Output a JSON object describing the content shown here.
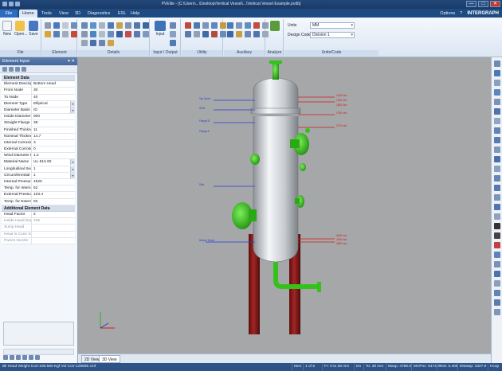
{
  "window": {
    "title": "PVElite - [C:\\Users\\...\\Desktop\\Vertical Vessel\\...\\Vertical Vessel Example.pvdb]",
    "minimize": "—",
    "maximize": "□",
    "close": "✕"
  },
  "menu": {
    "file": "File",
    "tabs": [
      "Home",
      "Tools",
      "View",
      "3D",
      "Diagnostics",
      "ESL",
      "Help"
    ],
    "options": "Options",
    "brand": "INTERGRAPH"
  },
  "ribbon": {
    "file_buttons": [
      "New",
      "Open...",
      "Save"
    ],
    "groups": [
      "File",
      "Element",
      "Details",
      "Input / Output",
      "Utility",
      "Auxiliary",
      "Analyze",
      "Units/Code"
    ],
    "input_button": "Input",
    "units_label": "Units",
    "units_value": "MM",
    "design_code_label": "Design Code",
    "design_code_value": "Division 1"
  },
  "element_input": {
    "title": "Element Input",
    "pin": "📌",
    "section_element": "Element Data",
    "rows": [
      {
        "k": "Element Description",
        "v": "Bottom Head"
      },
      {
        "k": "From Node",
        "v": "30"
      },
      {
        "k": "To Node",
        "v": "40"
      },
      {
        "k": "Element Type",
        "v": "Elliptical",
        "dd": true
      },
      {
        "k": "Diameter Basis",
        "v": "ID",
        "dd": true
      },
      {
        "k": "Inside Diameter in",
        "v": "900"
      },
      {
        "k": "Straight Flange Length",
        "v": "38"
      },
      {
        "k": "Finished Thickness",
        "v": "11"
      },
      {
        "k": "Nominal Thickness",
        "v": "14.7"
      },
      {
        "k": "Internal Corrosion",
        "v": "3"
      },
      {
        "k": "External Corrosion",
        "v": "0"
      },
      {
        "k": "Wind Diameter Mult",
        "v": "1.2"
      },
      {
        "k": "Material Name",
        "v": "UL-516 60",
        "dd": true
      },
      {
        "k": "Longitudinal Seam",
        "v": "1",
        "dd": true
      },
      {
        "k": "Circumferential Seam",
        "v": "1",
        "dd": true
      },
      {
        "k": "Internal Pressure",
        "v": "4620"
      },
      {
        "k": "Temp. for Internal",
        "v": "62"
      },
      {
        "k": "External Pressure",
        "v": "103.4"
      },
      {
        "k": "Temp. for External",
        "v": "82"
      }
    ],
    "section_additional": "Additional Element Data",
    "rows2": [
      {
        "k": "Head Factor",
        "v": "2"
      },
      {
        "k": "Inside Head Depth",
        "v": "225",
        "dim": true
      },
      {
        "k": "Sump Head",
        "v": "",
        "dim": true
      },
      {
        "k": "Head is Cone Spot",
        "v": "",
        "dim": true
      },
      {
        "k": "Parent Nozzle",
        "v": "",
        "dim": true
      }
    ]
  },
  "view": {
    "tabs": [
      "2D View",
      "3D View"
    ],
    "active_tab": "3D View",
    "left_labels": [
      "Top Head",
      "Shell",
      "Flange B",
      "Flange A",
      "Skirt",
      "Bottom Head"
    ],
    "right_labels": [
      "1000 mm",
      "1250 mm",
      "1500 mm",
      "1780 mm",
      "3720 mm",
      "4000 mm",
      "4200 mm",
      "4600 mm"
    ],
    "colors": {
      "background": "#a5a7a9",
      "vessel": "#d7dadd",
      "nozzle": "#34c21a",
      "support": "#8a1c1c",
      "left_label": "#2a3cdd",
      "right_label": "#d21c1c"
    }
  },
  "status": {
    "left": "Bil Head Weight Corr:196.580 Kgf  Vol Corr:129685 cmf",
    "cells": [
      "Item",
      "1 of 6",
      "Fr: 0 to 38 mm",
      "Dn",
      "To: 30 mm",
      "Maxp: 4780.0",
      "MAPnc: 5474.3",
      "Test: 5.409",
      "EMawp: 3327.9",
      "Hcop"
    ]
  }
}
